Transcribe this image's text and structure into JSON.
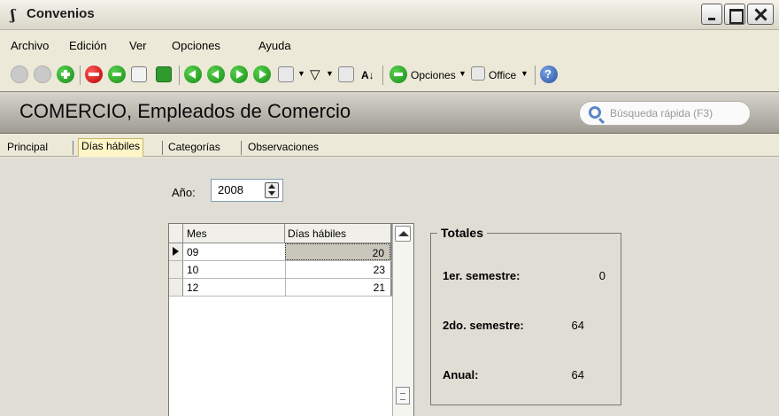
{
  "window": {
    "title": "Convenios"
  },
  "menu": {
    "items": [
      {
        "label": "Archivo"
      },
      {
        "label": "Edición"
      },
      {
        "label": "Ver"
      },
      {
        "label": "Opciones"
      },
      {
        "label": "Ayuda"
      }
    ]
  },
  "toolbar": {
    "opciones_label": "Opciones",
    "office_label": "Office",
    "icons": [
      "accept-icon",
      "cancel-icon",
      "add-icon",
      "delete-icon",
      "edit-icon",
      "print-preview-icon",
      "refresh-icon",
      "first-record-icon",
      "previous-record-icon",
      "next-record-icon",
      "last-record-icon",
      "binoculars-icon",
      "filter-icon",
      "columns-icon",
      "sort-icon",
      "options-icon",
      "office-icon",
      "help-icon"
    ]
  },
  "header": {
    "title": "COMERCIO, Empleados de Comercio",
    "search_placeholder": "Búsqueda rápida (F3)"
  },
  "tabs": [
    {
      "label": "Principal",
      "active": false
    },
    {
      "label": "Días hábiles",
      "active": true
    },
    {
      "label": "Categorías",
      "active": false
    },
    {
      "label": "Observaciones",
      "active": false
    }
  ],
  "year": {
    "label": "Año:",
    "value": "2008"
  },
  "grid": {
    "columns": [
      "Mes",
      "Días hábiles"
    ],
    "rows": [
      {
        "mes": "09",
        "dias": "20",
        "current": true
      },
      {
        "mes": "10",
        "dias": "23",
        "current": false
      },
      {
        "mes": "12",
        "dias": "21",
        "current": false
      }
    ]
  },
  "totales": {
    "title": "Totales",
    "items": [
      {
        "label": "1er. semestre:",
        "value": "0"
      },
      {
        "label": "2do. semestre:",
        "value": "64"
      },
      {
        "label": "Anual:",
        "value": "64"
      }
    ]
  }
}
